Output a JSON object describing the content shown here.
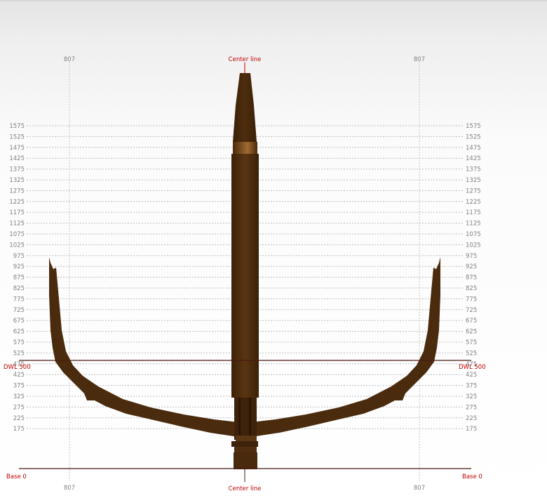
{
  "labels": {
    "center_line": "Center line",
    "dwl": "DWL 500",
    "base": "Base 0",
    "station": "807"
  },
  "waterlines": [
    "1575",
    "1525",
    "1475",
    "1425",
    "1375",
    "1325",
    "1275",
    "1225",
    "1175",
    "1125",
    "1075",
    "1025",
    "975",
    "925",
    "875",
    "825",
    "775",
    "725",
    "675",
    "625",
    "575",
    "525",
    "475",
    "425",
    "375",
    "325",
    "275",
    "225",
    "175"
  ],
  "colors": {
    "hull": "#4a2b0d",
    "hull_dark": "#3a2008",
    "hull_light": "#6a4418",
    "accent_red": "#c00000",
    "grid": "#bdbdbd",
    "tick_text": "#808080"
  }
}
